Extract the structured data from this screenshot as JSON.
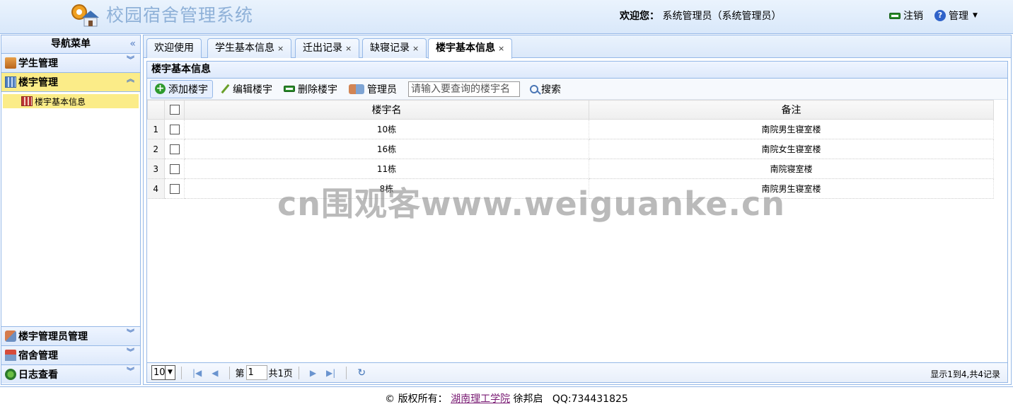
{
  "header": {
    "app_title": "校园宿舍管理系统",
    "welcome_label": "欢迎您：",
    "welcome_user": "系统管理员（系统管理员）",
    "logout_label": "注销",
    "manage_label": "管理"
  },
  "nav": {
    "title": "导航菜单",
    "sections": {
      "student": "学生管理",
      "building": "楼宇管理",
      "building_item": "楼宇基本信息",
      "building_admin": "楼宇管理员管理",
      "dorm": "宿舍管理",
      "log": "日志查看"
    }
  },
  "tabs": [
    {
      "label": "欢迎使用"
    },
    {
      "label": "学生基本信息"
    },
    {
      "label": "迁出记录"
    },
    {
      "label": "缺寝记录"
    },
    {
      "label": "楼宇基本信息"
    }
  ],
  "panel": {
    "title": "楼宇基本信息",
    "toolbar": {
      "add": "添加楼宇",
      "edit": "编辑楼宇",
      "delete": "删除楼宇",
      "admin": "管理员",
      "search_placeholder": "请输入要查询的楼宇名",
      "search": "搜索"
    },
    "columns": {
      "name": "楼宇名",
      "remark": "备注"
    },
    "rows": [
      {
        "no": "1",
        "name": "10栋",
        "remark": "南院男生寝室楼"
      },
      {
        "no": "2",
        "name": "16栋",
        "remark": "南院女生寝室楼"
      },
      {
        "no": "3",
        "name": "11栋",
        "remark": "南院寝室楼"
      },
      {
        "no": "4",
        "name": "8栋",
        "remark": "南院男生寝室楼"
      }
    ],
    "pager": {
      "page_size": "10",
      "page_prefix": "第",
      "page_value": "1",
      "page_suffix": "共1页",
      "info": "显示1到4,共4记录"
    }
  },
  "footer": {
    "copyright": "© 版权所有：",
    "org": "湖南理工学院",
    "author": "徐邦启",
    "qq": "QQ:734431825"
  },
  "watermark": "cn围观客www.weiguanke.cn"
}
